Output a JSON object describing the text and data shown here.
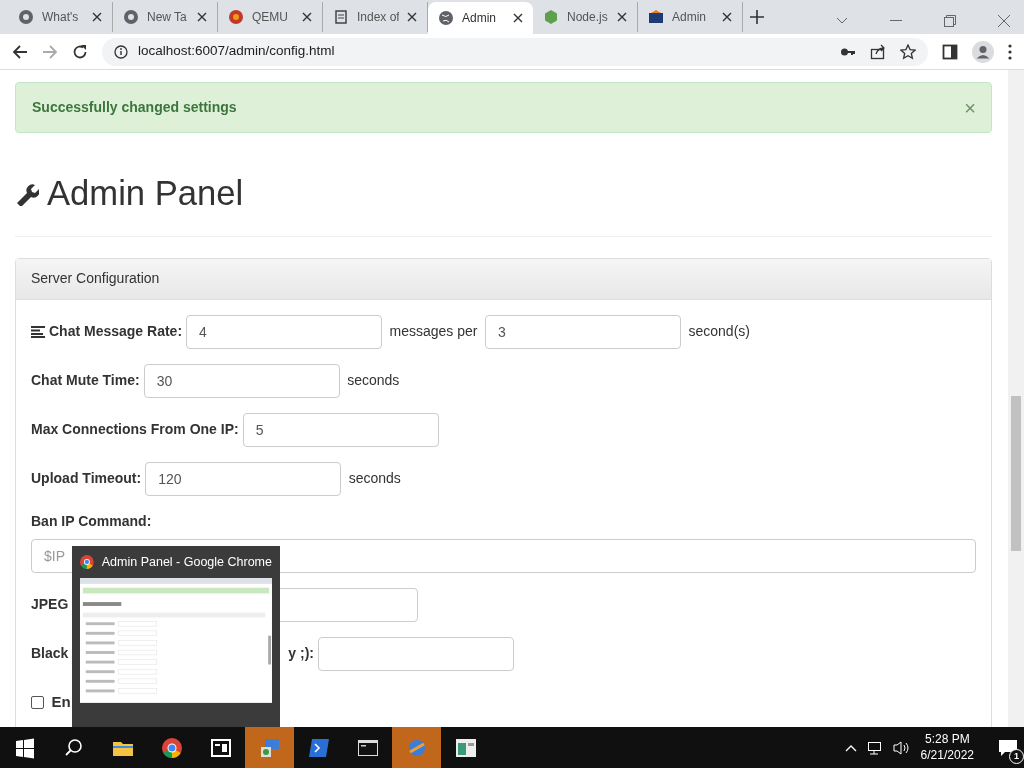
{
  "browser": {
    "tabs": [
      {
        "title": "What's",
        "selected": false
      },
      {
        "title": "New Ta",
        "selected": false
      },
      {
        "title": "QEMU",
        "selected": false
      },
      {
        "title": "Index of",
        "selected": false
      },
      {
        "title": "Admin",
        "selected": true
      },
      {
        "title": "Node.js",
        "selected": false
      },
      {
        "title": "Admin",
        "selected": false
      }
    ],
    "url": "localhost:6007/admin/config.html"
  },
  "alert": {
    "message": "Successfully changed settings",
    "close": "×"
  },
  "page_title": "Admin Panel",
  "panel": {
    "heading": "Server Configuration",
    "fields": [
      {
        "kind": "inline",
        "has_icon": true,
        "label": "Chat Message Rate:",
        "inputs": [
          {
            "value": "4",
            "suffix": "messages per"
          },
          {
            "value": "3",
            "suffix": "second(s)"
          }
        ]
      },
      {
        "kind": "inline",
        "label": "Chat Mute Time:",
        "inputs": [
          {
            "value": "30",
            "suffix": "seconds"
          }
        ]
      },
      {
        "kind": "inline",
        "label": "Max Connections From One IP:",
        "inputs": [
          {
            "value": "5"
          }
        ]
      },
      {
        "kind": "inline",
        "label": "Upload Timeout:",
        "inputs": [
          {
            "value": "120",
            "suffix": "seconds"
          }
        ]
      },
      {
        "kind": "stacked",
        "label": "Ban IP Command:",
        "inputs": [
          {
            "placeholder": "$IP"
          }
        ]
      },
      {
        "kind": "covered",
        "label": "JPEG"
      },
      {
        "kind": "covered",
        "label": "Black",
        "label_tail": "y ;):"
      },
      {
        "kind": "checkbox",
        "label": "En",
        "checked": false
      }
    ]
  },
  "preview": {
    "title": "Admin Panel - Google Chrome"
  },
  "taskbar": {
    "time": "5:28 PM",
    "date": "6/21/2022",
    "notifications": "1"
  }
}
